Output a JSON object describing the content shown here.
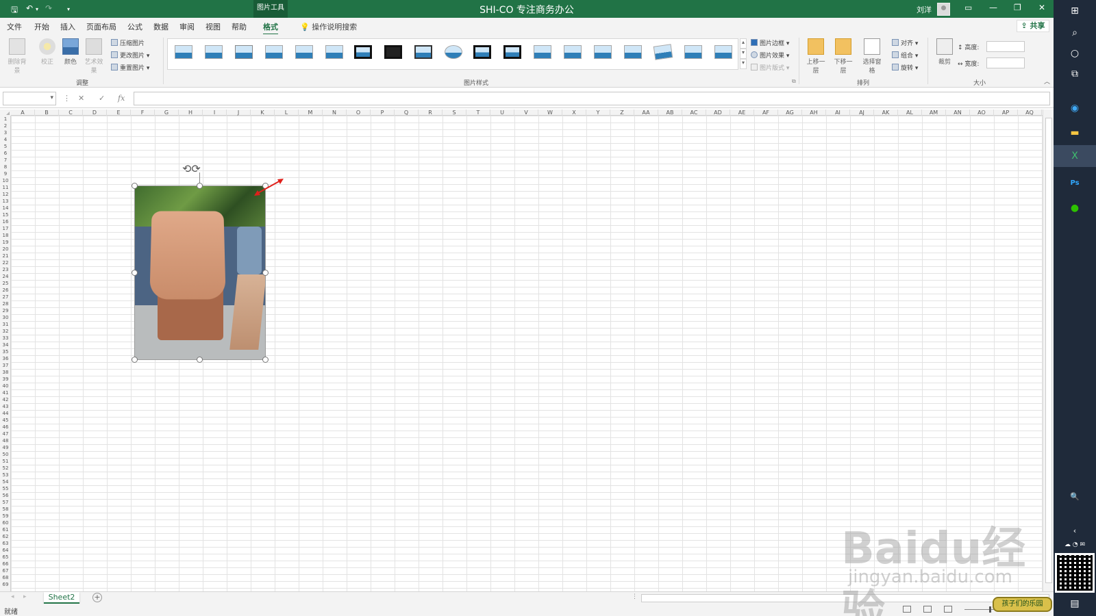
{
  "titlebar": {
    "context_tab": "图片工具",
    "doc_title": "SHI-CO 专注商务办公",
    "user_name": "刘洋",
    "icons": [
      "save-icon",
      "undo-icon",
      "redo-icon",
      "customize-icon",
      "ribbon-display-icon",
      "minimize-icon",
      "restore-icon",
      "close-icon"
    ]
  },
  "menu": {
    "tabs": [
      "文件",
      "开始",
      "插入",
      "页面布局",
      "公式",
      "数据",
      "审阅",
      "视图",
      "帮助",
      "格式"
    ],
    "active_tab": "格式",
    "tell_me": "操作说明搜索",
    "share": "共享"
  },
  "ribbon": {
    "adjust": {
      "remove_background": "删除背景",
      "corrections": "校正",
      "color": "颜色",
      "artistic": "艺术效果",
      "compress": "压缩图片",
      "change": "更改图片",
      "reset": "重置图片",
      "label": "调整"
    },
    "styles": {
      "label": "图片样式",
      "border": "图片边框",
      "effects": "图片效果",
      "layout": "图片版式"
    },
    "arrange": {
      "label": "排列",
      "bring_forward": "上移一层",
      "send_backward": "下移一层",
      "selection_pane": "选择窗格",
      "align": "对齐",
      "group": "组合",
      "rotate": "旋转"
    },
    "size": {
      "label": "大小",
      "crop": "裁剪",
      "height": "高度:",
      "width": "宽度:"
    }
  },
  "formula": {
    "fx": "fx",
    "cancel": "✕",
    "enter": "✓"
  },
  "grid": {
    "columns": [
      "A",
      "B",
      "C",
      "D",
      "E",
      "F",
      "G",
      "H",
      "I",
      "J",
      "K",
      "L",
      "M",
      "N",
      "O",
      "P",
      "Q",
      "R",
      "S",
      "T",
      "U",
      "V",
      "W",
      "X",
      "Y",
      "Z",
      "AA",
      "AB",
      "AC",
      "AD",
      "AE",
      "AF",
      "AG",
      "AH",
      "AI",
      "AJ",
      "AK",
      "AL",
      "AM",
      "AN",
      "AO",
      "AP",
      "AQ"
    ],
    "rows": [
      "1",
      "2",
      "3",
      "4",
      "5",
      "6",
      "7",
      "8",
      "9",
      "10",
      "11",
      "12",
      "13",
      "14",
      "15",
      "16",
      "17",
      "18",
      "19",
      "20",
      "21",
      "22",
      "23",
      "24",
      "25",
      "26",
      "27",
      "28",
      "29",
      "30",
      "31",
      "32",
      "33",
      "34",
      "35",
      "36",
      "37",
      "38",
      "39",
      "40",
      "41",
      "42",
      "43",
      "44",
      "45",
      "46",
      "47",
      "48",
      "49",
      "50",
      "51",
      "52",
      "53",
      "54",
      "55",
      "56",
      "57",
      "58",
      "59",
      "60",
      "61",
      "62",
      "63",
      "64",
      "65",
      "66",
      "67",
      "68",
      "69"
    ]
  },
  "sheets": {
    "tabs": [
      "Sheet2"
    ],
    "add": "+"
  },
  "status": {
    "text": "就绪"
  },
  "overlay_badge": "孩子们的乐园",
  "watermark": {
    "main": "Baidu经验",
    "sub": "jingyan.baidu.com"
  },
  "taskbar": {
    "icons": [
      "windows-icon",
      "search-icon",
      "cortana-icon",
      "task-view-icon",
      "edge-icon",
      "file-explorer-icon",
      "excel-icon",
      "photoshop-icon",
      "wechat-icon",
      "magnifier-icon",
      "chevron-left-icon",
      "tray-icons",
      "notification-icon"
    ]
  }
}
